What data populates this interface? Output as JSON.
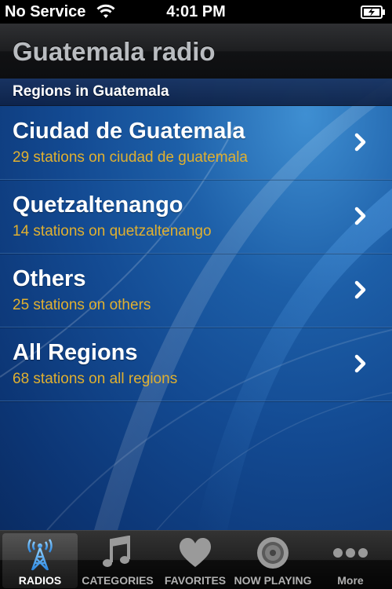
{
  "status_bar": {
    "carrier": "No Service",
    "time": "4:01 PM"
  },
  "nav_bar": {
    "title": "Guatemala radio"
  },
  "list": {
    "section_header": "Regions in Guatemala",
    "rows": [
      {
        "title": "Ciudad de Guatemala",
        "subtitle": "29 stations on ciudad de guatemala"
      },
      {
        "title": "Quetzaltenango",
        "subtitle": "14 stations on quetzaltenango"
      },
      {
        "title": "Others",
        "subtitle": "25 stations on others"
      },
      {
        "title": "All Regions",
        "subtitle": "68 stations on all regions"
      }
    ]
  },
  "tab_bar": {
    "tabs": [
      {
        "label": "RADIOS",
        "icon": "radio-tower-icon",
        "selected": true
      },
      {
        "label": "CATEGORIES",
        "icon": "music-note-icon",
        "selected": false
      },
      {
        "label": "FAVORITES",
        "icon": "heart-icon",
        "selected": false
      },
      {
        "label": "NOW PLAYING",
        "icon": "speaker-icon",
        "selected": false
      },
      {
        "label": "More",
        "icon": "more-dots-icon",
        "selected": false
      }
    ]
  },
  "colors": {
    "subtitle": "#e0b030",
    "selected_tab_icon": "#4aa6f0",
    "background": "#134a92"
  }
}
